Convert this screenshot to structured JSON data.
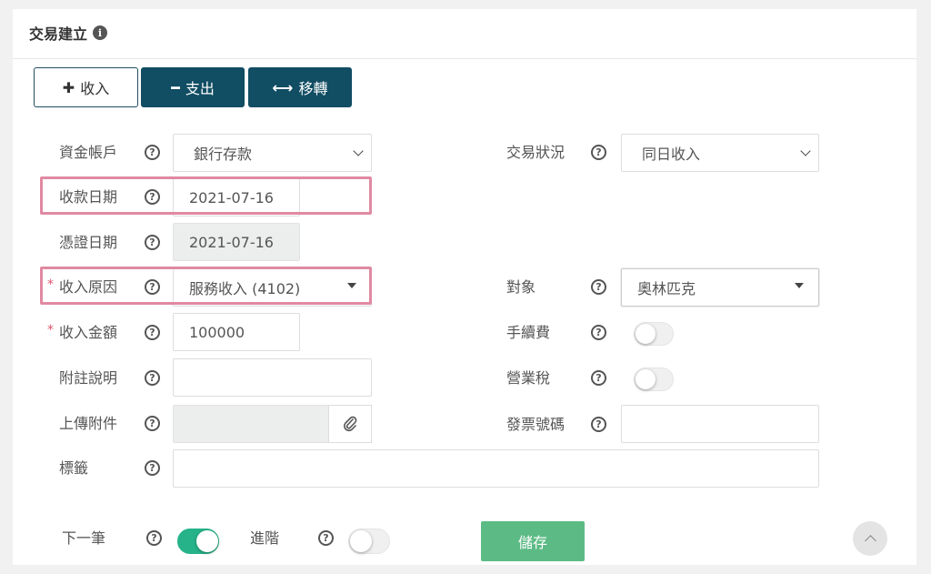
{
  "header": {
    "title": "交易建立",
    "info_icon": "i"
  },
  "type_buttons": {
    "income": {
      "icon": "✚",
      "label": "收入"
    },
    "expense": {
      "icon": "━",
      "label": "支出"
    },
    "transfer": {
      "icon": "⟷",
      "label": "移轉"
    }
  },
  "form": {
    "account": {
      "label": "資金帳戶",
      "value": "銀行存款"
    },
    "status": {
      "label": "交易狀況",
      "value": "同日收入"
    },
    "receipt_date": {
      "label": "收款日期",
      "value": "2021-07-16"
    },
    "voucher_date": {
      "label": "憑證日期",
      "value": "2021-07-16"
    },
    "reason": {
      "label": "收入原因",
      "value": "服務收入 (4102)",
      "required_mark": "*"
    },
    "counterparty": {
      "label": "對象",
      "value": "奧林匹克"
    },
    "amount": {
      "label": "收入金額",
      "value": "100000",
      "required_mark": "*"
    },
    "fee": {
      "label": "手續費",
      "enabled": false
    },
    "note": {
      "label": "附註說明",
      "value": ""
    },
    "business_tax": {
      "label": "營業稅",
      "enabled": false
    },
    "attachment": {
      "label": "上傳附件",
      "icon": "paperclip-icon"
    },
    "invoice_no": {
      "label": "發票號碼",
      "value": ""
    },
    "tags": {
      "label": "標籤",
      "value": ""
    }
  },
  "footer": {
    "next": {
      "label": "下一筆",
      "enabled": true
    },
    "advanced": {
      "label": "進階",
      "enabled": false
    },
    "save_label": "儲存"
  },
  "help_glyph": "?",
  "colors": {
    "primary_dark": "#114d63",
    "toggle_on": "#26b38a",
    "save": "#5cbb85",
    "highlight": "#e08aa2",
    "required": "#e0526e"
  }
}
